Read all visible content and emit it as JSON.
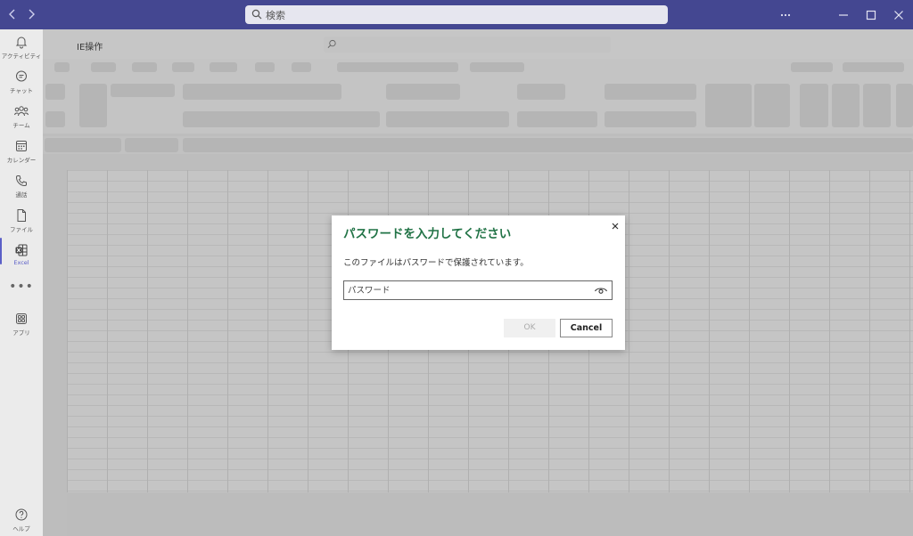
{
  "titlebar": {
    "search_placeholder": "検索",
    "back_icon": "chevron-left-icon",
    "forward_icon": "chevron-right-icon",
    "more_icon": "more-horizontal-icon",
    "minimize_icon": "minimize-icon",
    "maximize_icon": "maximize-icon",
    "close_icon": "close-icon",
    "color": "#444791"
  },
  "rail": {
    "items": [
      {
        "label": "アクティビティ",
        "icon": "bell-icon"
      },
      {
        "label": "チャット",
        "icon": "chat-icon"
      },
      {
        "label": "チーム",
        "icon": "teams-icon"
      },
      {
        "label": "カレンダー",
        "icon": "calendar-icon"
      },
      {
        "label": "通話",
        "icon": "phone-icon"
      },
      {
        "label": "ファイル",
        "icon": "file-icon"
      },
      {
        "label": "Excel",
        "icon": "excel-icon",
        "active": true
      },
      {
        "label": "アプリ",
        "icon": "apps-icon"
      }
    ],
    "more": "•••",
    "help_label": "ヘルプ",
    "accent": "#5b5fc7"
  },
  "document": {
    "title": "IE操作"
  },
  "dialog": {
    "title": "パスワードを入力してください",
    "message": "このファイルはパスワードで保護されています。",
    "password_placeholder": "パスワード",
    "ok_label": "OK",
    "cancel_label": "Cancel",
    "title_color": "#217346"
  }
}
